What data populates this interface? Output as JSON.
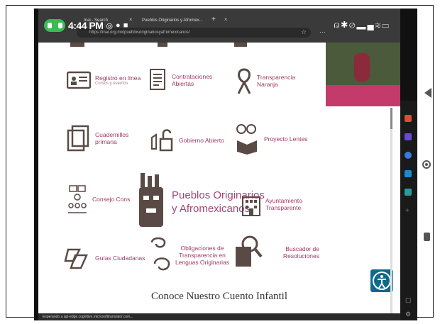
{
  "status_bar": {
    "time": "4:44 PM"
  },
  "browser": {
    "tabs": [
      {
        "label": "Inai - Search"
      },
      {
        "label": "Pueblos Originarios y Afromex..."
      }
    ],
    "url": "https://inai.org.mx/pueblosoriginariosyafromexicanos/",
    "loading_status": "Esperando a api-edge.cognitive.microsofttranslator.com..."
  },
  "services": [
    {
      "id": "registro",
      "label": "Registro en línea",
      "sub": "Cursos y eventos"
    },
    {
      "id": "contrataciones",
      "label": "Contrataciones Abiertas"
    },
    {
      "id": "transparencia-naranja",
      "label": "Transparencia Naranja"
    },
    {
      "id": "cuadernillos",
      "label": "Cuadernillos primaria"
    },
    {
      "id": "gobierno-abierto",
      "label": "Gobierno Abierto"
    },
    {
      "id": "proyecto-lentes",
      "label": "Proyecto Lentes"
    },
    {
      "id": "consejo",
      "label": "Consejo Cons"
    },
    {
      "id": "pueblos",
      "label_line1": "Pueblos Originarios",
      "label_line2": "y Afromexicanos"
    },
    {
      "id": "ayuntamiento",
      "label": "Ayuntamiento Transparente"
    },
    {
      "id": "guias",
      "label": "Guías Ciudadanas"
    },
    {
      "id": "obligaciones",
      "label": "Obligaciones de Transparencia en Lenguas Originarias"
    },
    {
      "id": "buscador",
      "label": "Buscador de Resoluciones"
    }
  ],
  "footer": {
    "title": "Conoce Nuestro Cuento Infantil"
  },
  "colors": {
    "accent": "#9b3a63",
    "icon": "#5a4a45"
  }
}
